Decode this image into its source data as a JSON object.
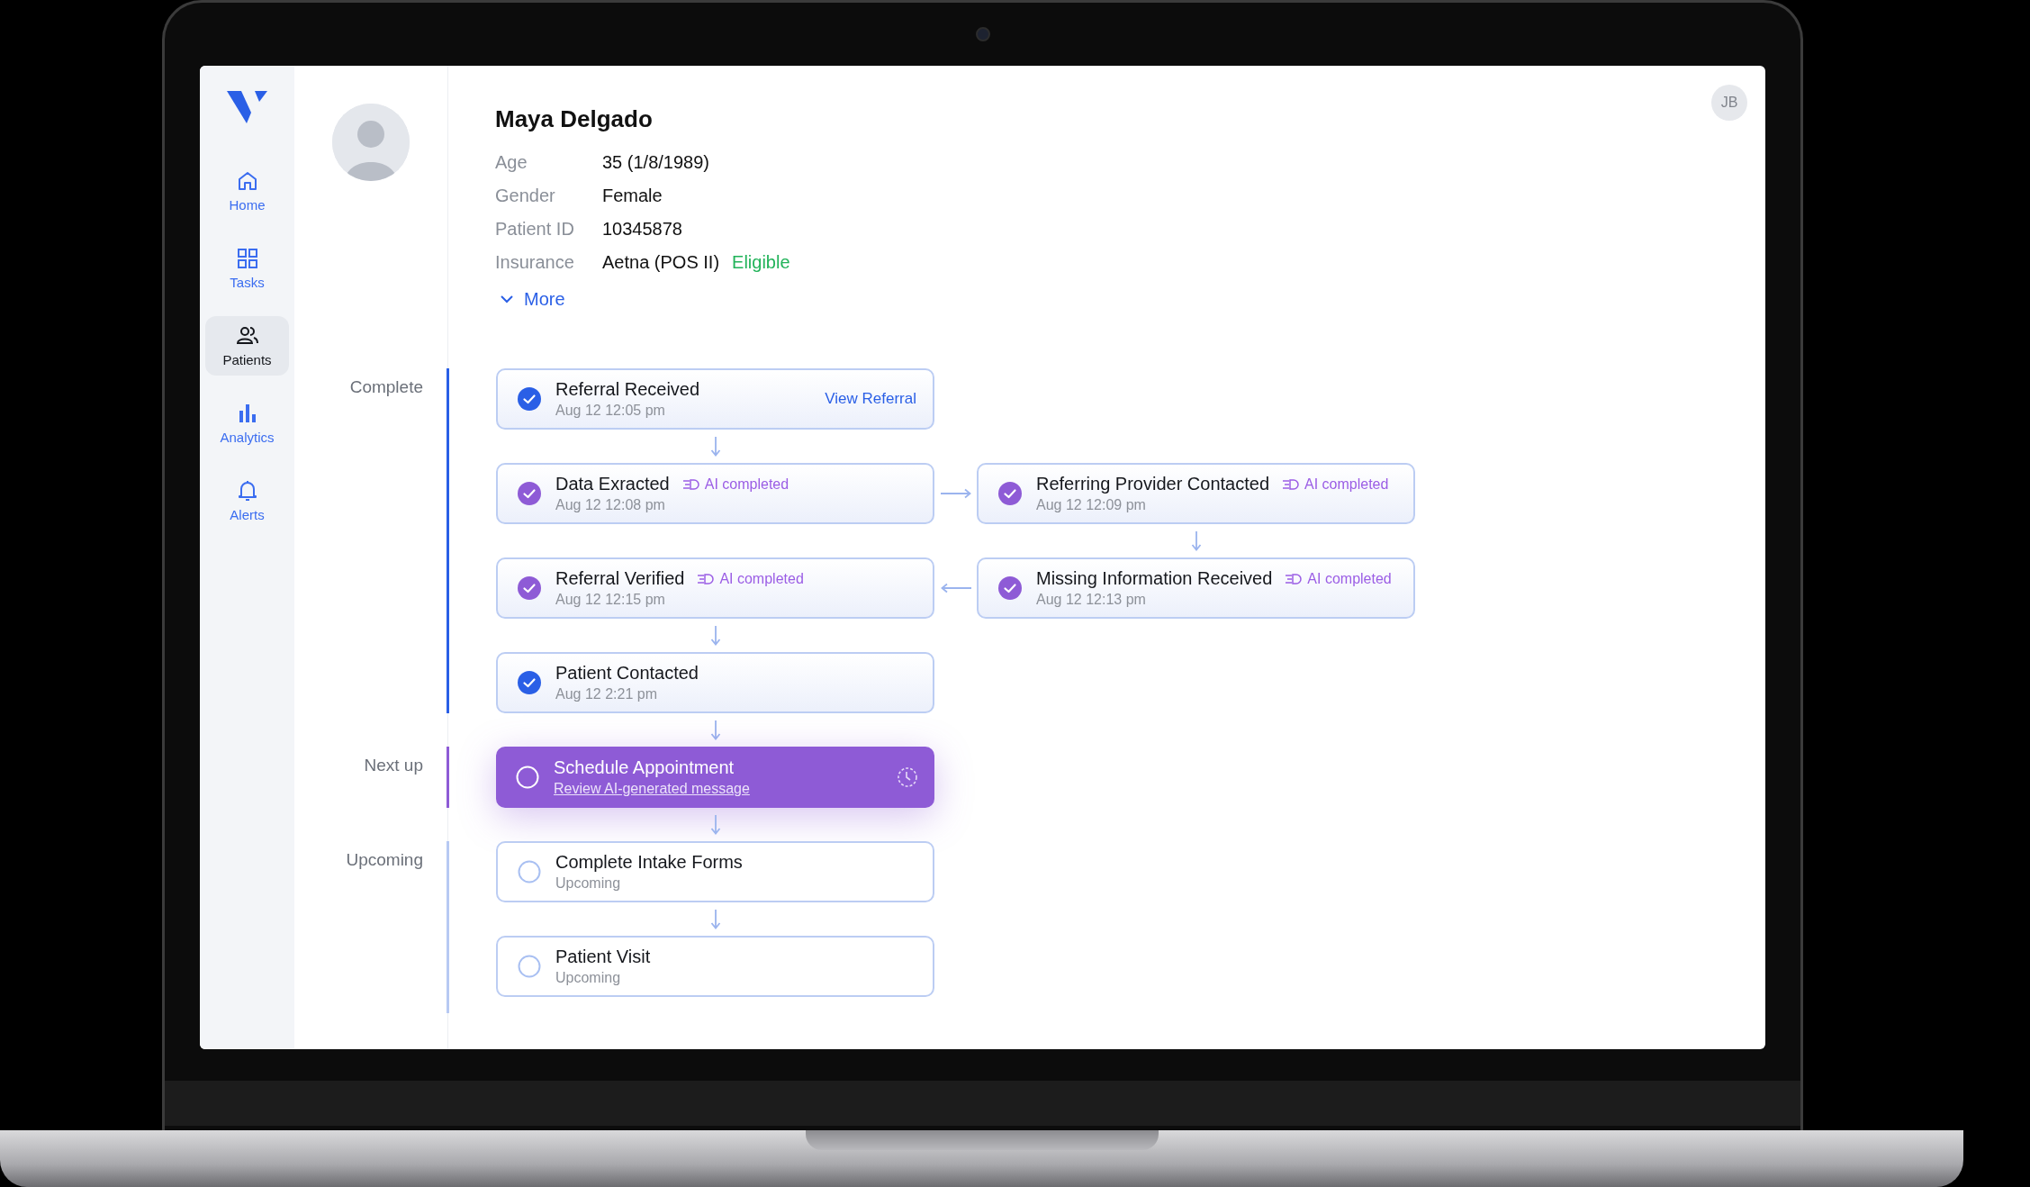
{
  "user_initials": "JB",
  "sidebar": {
    "items": [
      {
        "label": "Home",
        "kind": "home",
        "selected": false
      },
      {
        "label": "Tasks",
        "kind": "tasks",
        "selected": false
      },
      {
        "label": "Patients",
        "kind": "patients",
        "selected": true
      },
      {
        "label": "Analytics",
        "kind": "analytics",
        "selected": false
      },
      {
        "label": "Alerts",
        "kind": "alerts",
        "selected": false
      }
    ]
  },
  "patient": {
    "name": "Maya Delgado",
    "fields": [
      {
        "label": "Age",
        "value": "35 (1/8/1989)"
      },
      {
        "label": "Gender",
        "value": "Female"
      },
      {
        "label": "Patient ID",
        "value": "10345878"
      },
      {
        "label": "Insurance",
        "value": "Aetna (POS II)",
        "status": "Eligible"
      }
    ],
    "more": "More"
  },
  "stages": [
    {
      "label": "Complete",
      "kind": "complete",
      "rows": [
        {
          "kind": "single",
          "steps": [
            {
              "title": "Referral Received",
              "subtitle": "Aug 12 12:05 pm",
              "kind": "manual",
              "checked": true,
              "link": "View Referral"
            }
          ]
        },
        {
          "kind": "forward",
          "steps": [
            {
              "title": "Data Exracted",
              "subtitle": "Aug 12 12:08 pm",
              "kind": "ai",
              "checked": true,
              "badge": "AI completed"
            },
            {
              "title": "Referring Provider Contacted",
              "subtitle": "Aug 12 12:09 pm",
              "kind": "ai",
              "checked": true,
              "badge": "AI completed"
            }
          ]
        },
        {
          "kind": "backward",
          "steps": [
            {
              "title": "Referral Verified",
              "subtitle": "Aug 12 12:15 pm",
              "kind": "ai",
              "checked": true,
              "badge": "AI completed"
            },
            {
              "title": "Missing Information Received",
              "subtitle": "Aug 12 12:13 pm",
              "kind": "ai",
              "checked": true,
              "badge": "AI completed"
            }
          ]
        },
        {
          "kind": "single",
          "steps": [
            {
              "title": "Patient Contacted",
              "subtitle": "Aug 12 2:21 pm",
              "kind": "manual",
              "checked": true
            }
          ]
        }
      ]
    },
    {
      "label": "Next up",
      "kind": "next",
      "rows": [
        {
          "kind": "single",
          "steps": [
            {
              "title": "Schedule Appointment",
              "subtitle": "Review AI-generated message",
              "kind": "current",
              "checked": false
            }
          ]
        }
      ]
    },
    {
      "label": "Upcoming",
      "kind": "upcoming",
      "rows": [
        {
          "kind": "single",
          "steps": [
            {
              "title": "Complete Intake Forms",
              "subtitle": "Upcoming",
              "kind": "upcoming",
              "checked": false
            }
          ]
        },
        {
          "kind": "single",
          "steps": [
            {
              "title": "Patient Visit",
              "subtitle": "Upcoming",
              "kind": "upcoming",
              "checked": false
            }
          ]
        }
      ]
    }
  ]
}
